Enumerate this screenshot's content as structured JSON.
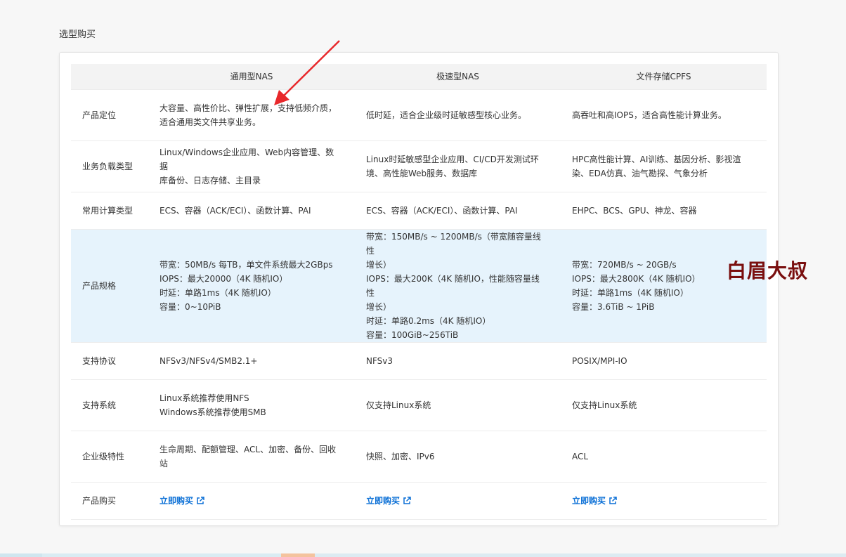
{
  "section_title": "选型购买",
  "columns": [
    "",
    "通用型NAS",
    "极速型NAS",
    "文件存储CPFS"
  ],
  "rows": [
    {
      "label": "产品定位",
      "cells": [
        [
          "大容量、高性价比、弹性扩展，支持低频介质，",
          "适合通用类文件共享业务。"
        ],
        [
          "低时延，适合企业级时延敏感型核心业务。"
        ],
        [
          "高吞吐和高IOPS，适合高性能计算业务。"
        ]
      ]
    },
    {
      "label": "业务负载类型",
      "cells": [
        [
          "Linux/Windows企业应用、Web内容管理、数据",
          "库备份、日志存储、主目录"
        ],
        [
          "Linux时延敏感型企业应用、CI/CD开发测试环",
          "境、高性能Web服务、数据库"
        ],
        [
          "HPC高性能计算、AI训练、基因分析、影视渲",
          "染、EDA仿真、油气勘探、气象分析"
        ]
      ]
    },
    {
      "label": "常用计算类型",
      "cells": [
        [
          "ECS、容器（ACK/ECI）、函数计算、PAI"
        ],
        [
          "ECS、容器（ACK/ECI）、函数计算、PAI"
        ],
        [
          "EHPC、BCS、GPU、神龙、容器"
        ]
      ]
    },
    {
      "label": "产品规格",
      "highlight": true,
      "cells": [
        [
          "带宽：50MB/s 每TB，单文件系统最大2GBps",
          "IOPS：最大20000（4K 随机IO）",
          "时延：单路1ms（4K 随机IO）",
          "容量：0~10PiB"
        ],
        [
          "带宽：150MB/s ~ 1200MB/s（带宽随容量线性",
          "增长）",
          "IOPS：最大200K（4K 随机IO，性能随容量线性",
          "增长）",
          "时延：单路0.2ms（4K 随机IO）",
          "容量：100GiB~256TiB"
        ],
        [
          "带宽：720MB/s ~ 20GB/s",
          "IOPS：最大2800K（4K 随机IO）",
          "时延：单路1ms（4K 随机IO）",
          "容量：3.6TiB ~ 1PiB"
        ]
      ]
    },
    {
      "label": "支持协议",
      "cells": [
        [
          "NFSv3/NFSv4/SMB2.1+"
        ],
        [
          "NFSv3"
        ],
        [
          "POSIX/MPI-IO"
        ]
      ]
    },
    {
      "label": "支持系统",
      "cells": [
        [
          "Linux系统推荐使用NFS",
          "Windows系统推荐使用SMB"
        ],
        [
          "仅支持Linux系统"
        ],
        [
          "仅支持Linux系统"
        ]
      ]
    },
    {
      "label": "企业级特性",
      "cells": [
        [
          "生命周期、配额管理、ACL、加密、备份、回收",
          "站"
        ],
        [
          "快照、加密、IPv6"
        ],
        [
          "ACL"
        ]
      ]
    }
  ],
  "buy_row": {
    "label": "产品购买",
    "link_label": "立即购买",
    "icon": "external-link-icon"
  },
  "watermark": "白眉大叔",
  "colors": {
    "highlight_row": "#e6f3fc",
    "link": "#0a6fd6",
    "arrow": "#e8282b",
    "watermark": "#7a0f0f"
  }
}
